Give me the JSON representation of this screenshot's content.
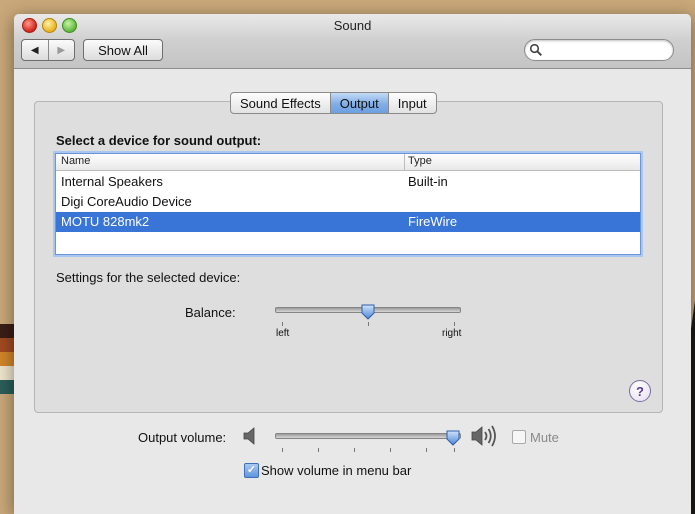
{
  "window": {
    "title": "Sound",
    "nav": {
      "back": "◀",
      "forward": "▶"
    },
    "show_all": "Show All",
    "search": {
      "value": "",
      "placeholder": ""
    }
  },
  "tabs": [
    {
      "label": "Sound Effects",
      "selected": false
    },
    {
      "label": "Output",
      "selected": true
    },
    {
      "label": "Input",
      "selected": false
    }
  ],
  "output": {
    "heading": "Select a device for sound output:",
    "columns": [
      "Name",
      "Type"
    ],
    "devices": [
      {
        "name": "Internal Speakers",
        "type": "Built-in",
        "selected": false
      },
      {
        "name": "Digi CoreAudio Device",
        "type": "",
        "selected": false
      },
      {
        "name": "MOTU 828mk2",
        "type": "FireWire",
        "selected": true
      }
    ],
    "settings_heading": "Settings for the selected device:",
    "balance": {
      "label": "Balance:",
      "left": "left",
      "right": "right",
      "value": 0.49
    }
  },
  "help": {
    "label": "?"
  },
  "volume": {
    "label": "Output volume:",
    "value": 0.9,
    "mute_label": "Mute",
    "muted": false,
    "show_in_menu_bar_label": "Show volume in menu bar",
    "show_in_menu_bar": true
  },
  "colors": {
    "selection": "#3875d7",
    "tab_selected": "#82aee6",
    "help_purple": "#5b3a96"
  },
  "icons": [
    "speaker-low-icon",
    "speaker-high-icon",
    "search-icon",
    "help-icon"
  ]
}
